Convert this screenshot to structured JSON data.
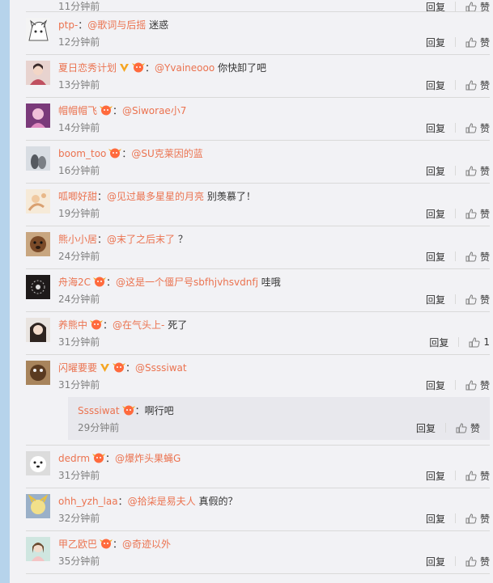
{
  "top_partial": {
    "time": "11分钟前",
    "reply": "回复",
    "like": "赞"
  },
  "comments": [
    {
      "user": "ptp-",
      "vip": false,
      "badge": false,
      "mention": "@歌词与后摇",
      "text": "迷惑",
      "time": "12分钟前",
      "reply": "回复",
      "like": "赞"
    },
    {
      "user": "夏日恋秀计划",
      "vip": true,
      "badge": true,
      "mention": "@Yvaineooo",
      "text": "你快卸了吧",
      "time": "13分钟前",
      "reply": "回复",
      "like": "赞"
    },
    {
      "user": "帽帽帽飞",
      "vip": false,
      "badge": true,
      "mention": "@Siworae小7",
      "text": "",
      "time": "14分钟前",
      "reply": "回复",
      "like": "赞"
    },
    {
      "user": "boom_too",
      "vip": false,
      "badge": true,
      "mention": "@SU克莱因的蓝",
      "text": "",
      "time": "16分钟前",
      "reply": "回复",
      "like": "赞"
    },
    {
      "user": "呱唧好甜",
      "vip": false,
      "badge": false,
      "mention": "@见过最多星星的月亮",
      "text": "别羡慕了！",
      "time": "19分钟前",
      "reply": "回复",
      "like": "赞"
    },
    {
      "user": "熊小小居",
      "vip": false,
      "badge": false,
      "mention": "@末了之后末了",
      "text": "？",
      "time": "24分钟前",
      "reply": "回复",
      "like": "赞"
    },
    {
      "user": "舟海2C",
      "vip": false,
      "badge": true,
      "mention": "@这是一个僵尸号sbfhjvhsvdnfj",
      "text": "哇哦",
      "time": "24分钟前",
      "reply": "回复",
      "like": "赞"
    },
    {
      "user": "养熊中",
      "vip": false,
      "badge": true,
      "mention": "@在气头上-",
      "text": "死了",
      "time": "31分钟前",
      "reply": "回复",
      "like": "1"
    },
    {
      "user": "闪曜要要",
      "vip": true,
      "badge": true,
      "mention": "@Ssssiwat",
      "text": "",
      "time": "31分钟前",
      "reply": "回复",
      "like": "赞"
    },
    {
      "user": "dedrm",
      "vip": false,
      "badge": true,
      "mention": "@爆炸头果蝇G",
      "text": "",
      "time": "31分钟前",
      "reply": "回复",
      "like": "赞"
    },
    {
      "user": "ohh_yzh_laa",
      "vip": false,
      "badge": false,
      "mention": "@拾柒是易夫人",
      "text": "真假的？",
      "time": "32分钟前",
      "reply": "回复",
      "like": "赞"
    },
    {
      "user": "甲乙欧巴",
      "vip": false,
      "badge": true,
      "mention": "@奇迹以外",
      "text": "",
      "time": "35分钟前",
      "reply": "回复",
      "like": "赞"
    }
  ],
  "subreply": {
    "user": "Ssssiwat",
    "badge": true,
    "text": "啊行吧",
    "time": "29分钟前",
    "reply": "回复",
    "like": "赞"
  },
  "colors": {
    "username": "#eb7350",
    "feed_bg": "#f2f2f5",
    "sidebar": "#b6d3eb",
    "vip": "#f5a623",
    "badge": "#ff6a3d"
  }
}
